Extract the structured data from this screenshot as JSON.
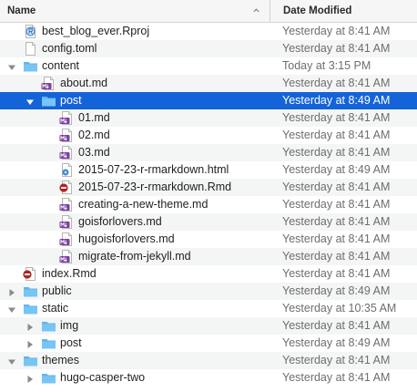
{
  "header": {
    "name": "Name",
    "date_modified": "Date Modified"
  },
  "rows": [
    {
      "name": "best_blog_ever.Rproj",
      "date": "Yesterday at 8:41 AM",
      "icon": "rproj-icon",
      "depth": 0,
      "disclosure": "none",
      "selected": false
    },
    {
      "name": "config.toml",
      "date": "Yesterday at 8:41 AM",
      "icon": "document-icon",
      "depth": 0,
      "disclosure": "none",
      "selected": false
    },
    {
      "name": "content",
      "date": "Today at 3:15 PM",
      "icon": "folder-icon",
      "depth": 0,
      "disclosure": "expanded",
      "selected": false
    },
    {
      "name": "about.md",
      "date": "Yesterday at 8:41 AM",
      "icon": "md-file-icon",
      "depth": 1,
      "disclosure": "none",
      "selected": false
    },
    {
      "name": "post",
      "date": "Yesterday at 8:49 AM",
      "icon": "folder-icon",
      "depth": 1,
      "disclosure": "expanded",
      "selected": true
    },
    {
      "name": "01.md",
      "date": "Yesterday at 8:41 AM",
      "icon": "md-file-icon",
      "depth": 2,
      "disclosure": "none",
      "selected": false
    },
    {
      "name": "02.md",
      "date": "Yesterday at 8:41 AM",
      "icon": "md-file-icon",
      "depth": 2,
      "disclosure": "none",
      "selected": false
    },
    {
      "name": "03.md",
      "date": "Yesterday at 8:41 AM",
      "icon": "md-file-icon",
      "depth": 2,
      "disclosure": "none",
      "selected": false
    },
    {
      "name": "2015-07-23-r-rmarkdown.html",
      "date": "Yesterday at 8:49 AM",
      "icon": "html-file-icon",
      "depth": 2,
      "disclosure": "none",
      "selected": false
    },
    {
      "name": "2015-07-23-r-rmarkdown.Rmd",
      "date": "Yesterday at 8:41 AM",
      "icon": "rmd-file-icon",
      "depth": 2,
      "disclosure": "none",
      "selected": false
    },
    {
      "name": "creating-a-new-theme.md",
      "date": "Yesterday at 8:41 AM",
      "icon": "md-file-icon",
      "depth": 2,
      "disclosure": "none",
      "selected": false
    },
    {
      "name": "goisforlovers.md",
      "date": "Yesterday at 8:41 AM",
      "icon": "md-file-icon",
      "depth": 2,
      "disclosure": "none",
      "selected": false
    },
    {
      "name": "hugoisforlovers.md",
      "date": "Yesterday at 8:41 AM",
      "icon": "md-file-icon",
      "depth": 2,
      "disclosure": "none",
      "selected": false
    },
    {
      "name": "migrate-from-jekyll.md",
      "date": "Yesterday at 8:41 AM",
      "icon": "md-file-icon",
      "depth": 2,
      "disclosure": "none",
      "selected": false
    },
    {
      "name": "index.Rmd",
      "date": "Yesterday at 8:41 AM",
      "icon": "rmd-file-icon",
      "depth": 0,
      "disclosure": "none",
      "selected": false
    },
    {
      "name": "public",
      "date": "Yesterday at 8:49 AM",
      "icon": "folder-icon",
      "depth": 0,
      "disclosure": "collapsed",
      "selected": false
    },
    {
      "name": "static",
      "date": "Yesterday at 10:35 AM",
      "icon": "folder-icon",
      "depth": 0,
      "disclosure": "expanded",
      "selected": false
    },
    {
      "name": "img",
      "date": "Yesterday at 8:41 AM",
      "icon": "folder-icon",
      "depth": 1,
      "disclosure": "collapsed",
      "selected": false
    },
    {
      "name": "post",
      "date": "Yesterday at 8:49 AM",
      "icon": "folder-icon",
      "depth": 1,
      "disclosure": "collapsed",
      "selected": false
    },
    {
      "name": "themes",
      "date": "Yesterday at 8:41 AM",
      "icon": "folder-icon",
      "depth": 0,
      "disclosure": "expanded",
      "selected": false
    },
    {
      "name": "hugo-casper-two",
      "date": "Yesterday at 8:41 AM",
      "icon": "folder-icon",
      "depth": 1,
      "disclosure": "collapsed",
      "selected": false
    }
  ],
  "colors": {
    "selection": "#1563d8",
    "folder": "#5fb6ef",
    "md_badge": "#7b3fa0",
    "rmd_badge": "#b22222",
    "html_badge": "#3a86d4",
    "rproj_badge": "#2a6fc9"
  }
}
